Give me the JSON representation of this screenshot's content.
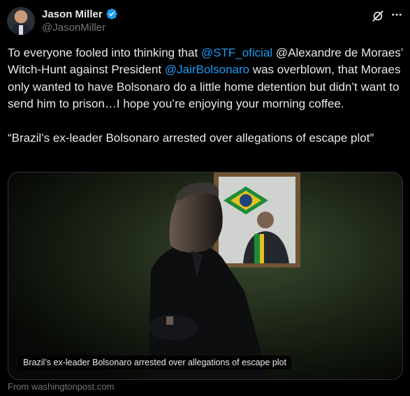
{
  "author": {
    "name": "Jason Miller",
    "handle": "@JasonMiller",
    "verified": true
  },
  "icons": [
    "verified-badge-icon",
    "grok-icon",
    "more-icon"
  ],
  "post": {
    "text_parts": [
      {
        "text": "To everyone fooled into thinking that ",
        "type": "text"
      },
      {
        "text": "@STF_oficial",
        "type": "mention"
      },
      {
        "text": " @Alexandre de Moraes’ Witch-Hunt against President ",
        "type": "text"
      },
      {
        "text": "@JairBolsonaro",
        "type": "mention"
      },
      {
        "text": " was overblown, that Moraes only wanted to have Bolsonaro do a little home detention but didn’t want to send him to prison…I hope you’re enjoying your morning coffee.\n\n“Brazil’s ex-leader Bolsonaro arrested over allegations of escape plot”",
        "type": "text"
      }
    ]
  },
  "card": {
    "caption": "Brazil’s ex-leader Bolsonaro arrested over allegations of escape plot",
    "source": "From washingtonpost.com"
  },
  "colors": {
    "background": "#000000",
    "text": "#e7e9ea",
    "secondary": "#71767b",
    "link": "#1d9bf0",
    "border": "#2f3336"
  }
}
